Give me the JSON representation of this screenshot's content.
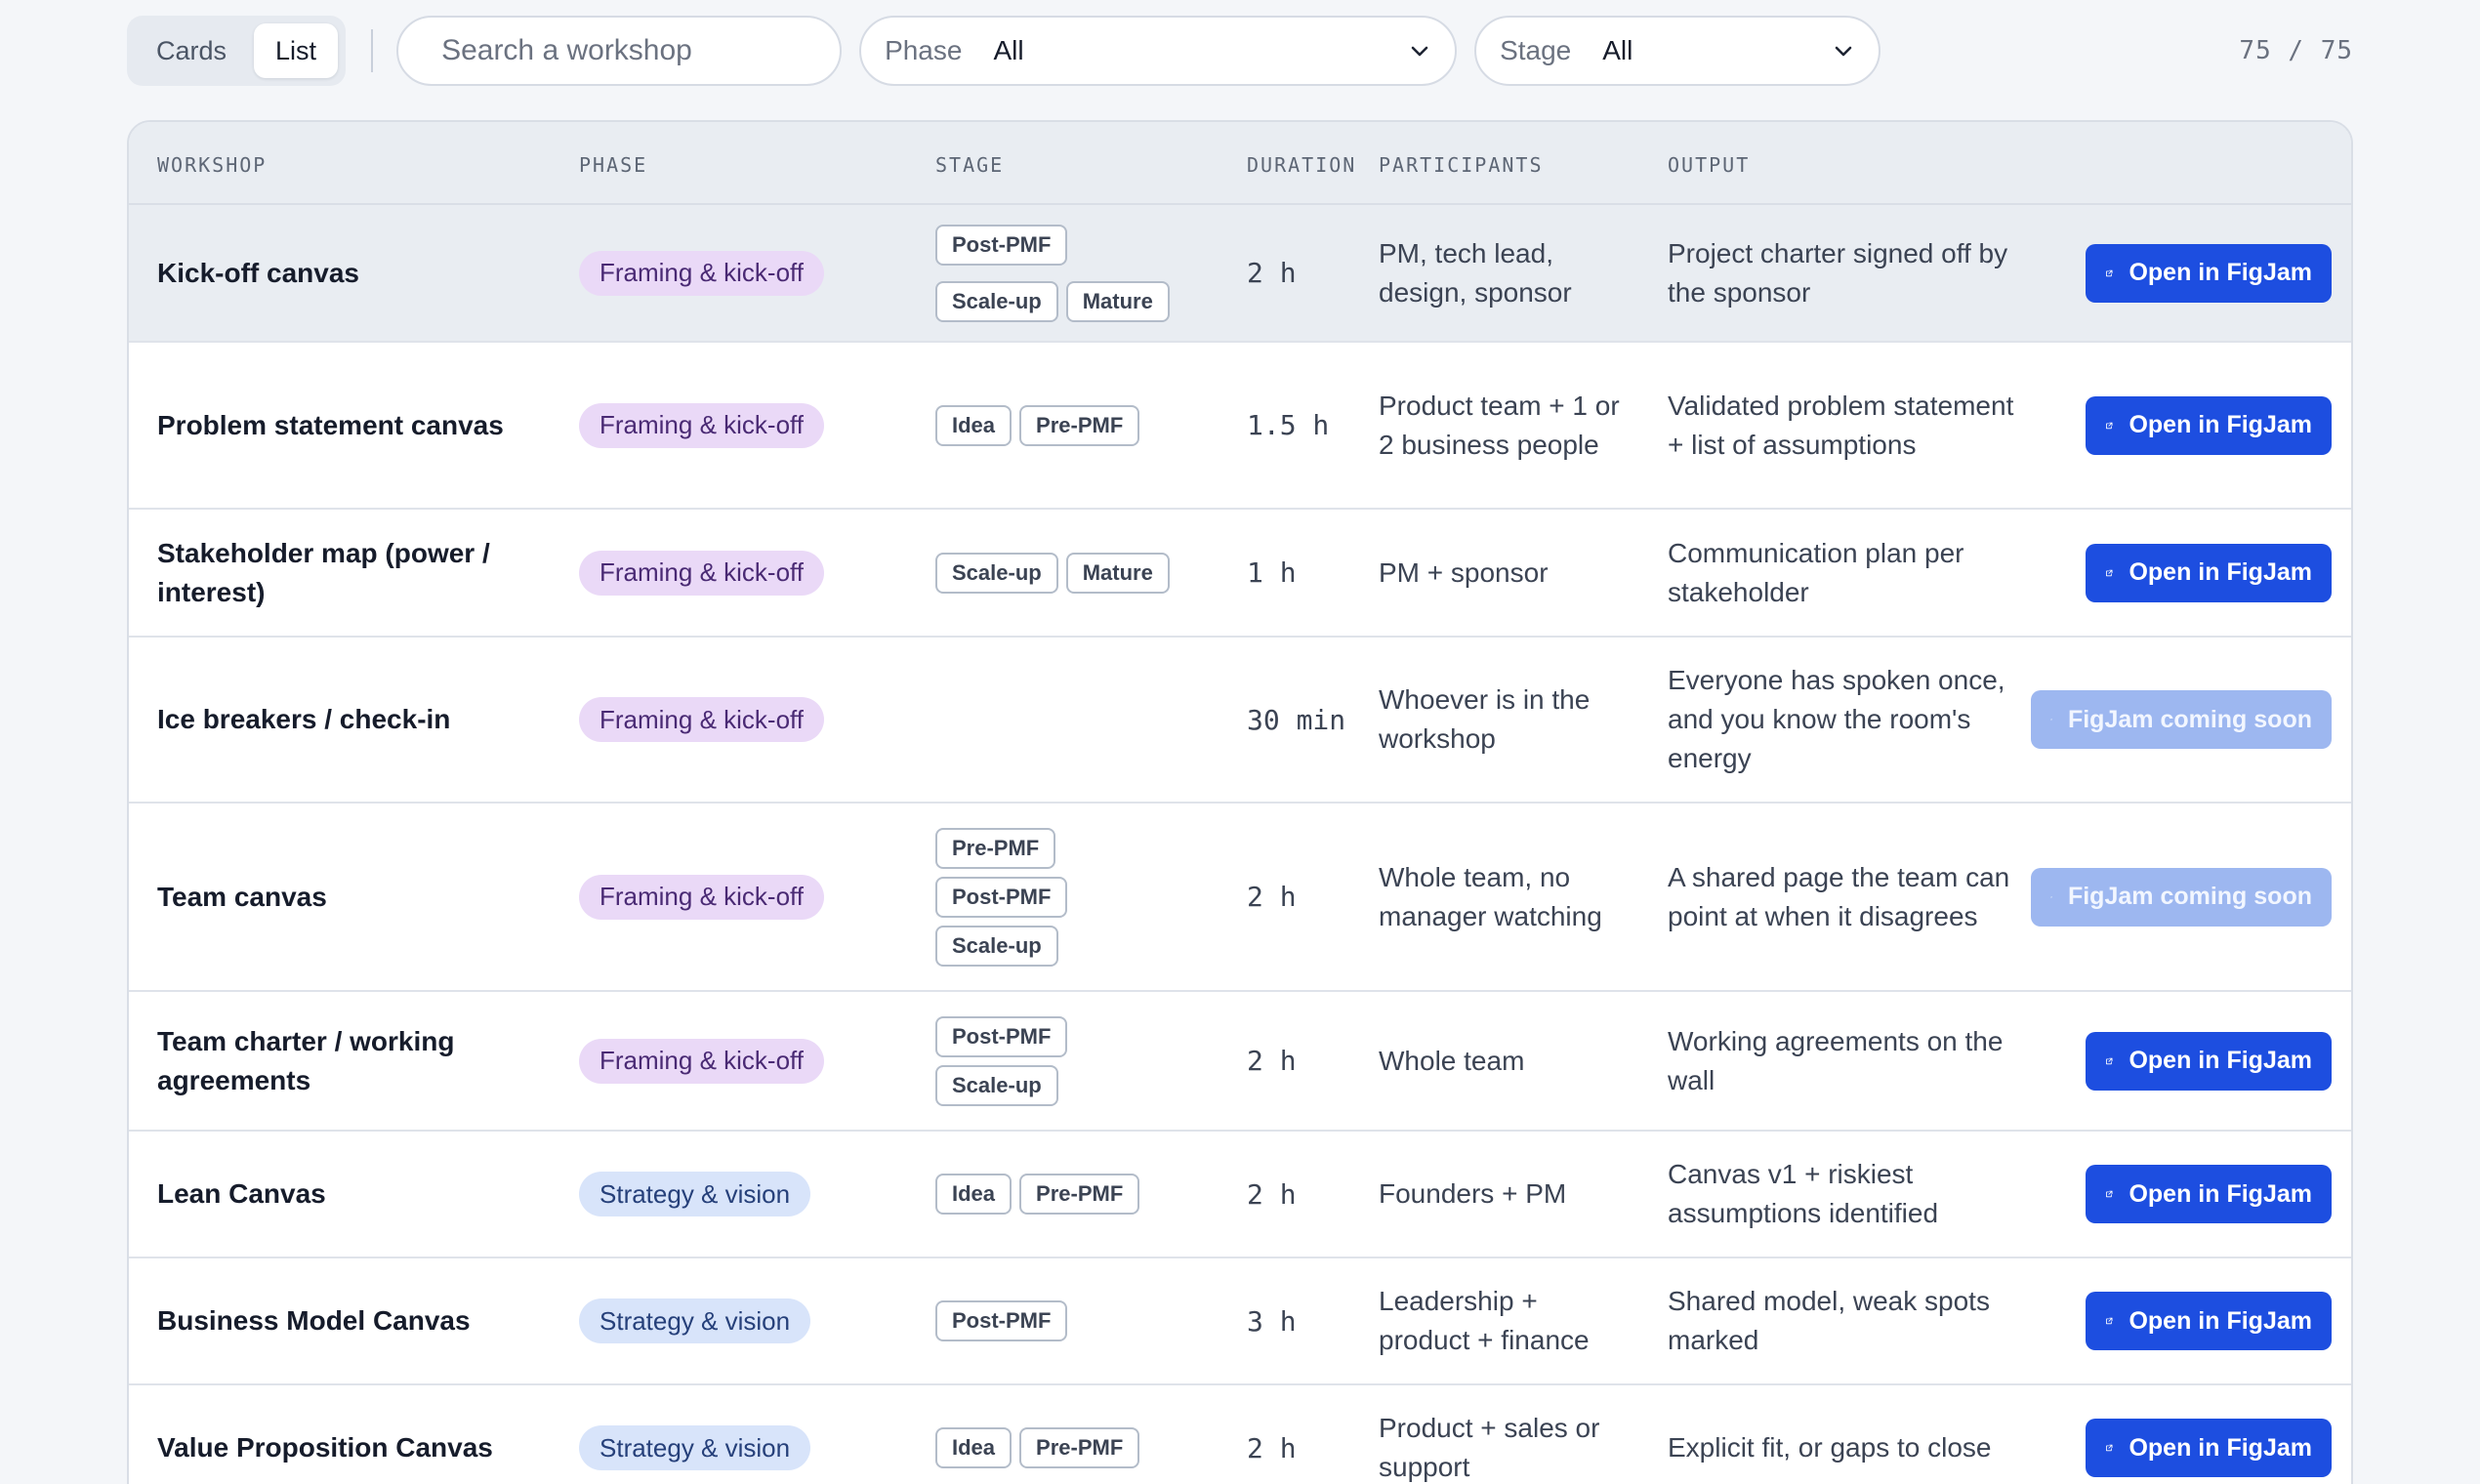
{
  "toolbar": {
    "view_cards": "Cards",
    "view_list": "List",
    "search_placeholder": "Search a workshop",
    "phase_label": "Phase",
    "phase_value": "All",
    "stage_label": "Stage",
    "stage_value": "All",
    "count": "75 / 75"
  },
  "table": {
    "headers": {
      "workshop": "WORKSHOP",
      "phase": "PHASE",
      "stage": "STAGE",
      "duration": "DURATION",
      "participants": "PARTICIPANTS",
      "output": "OUTPUT"
    },
    "rows": [
      {
        "name": "Kick-off canvas",
        "phase": "Framing & kick-off",
        "phase_kind": "framing",
        "stages": [
          "Post-PMF",
          "Scale-up",
          "Mature"
        ],
        "duration": "2 h",
        "participants": "PM, tech lead, design, sponsor",
        "output": "Project charter signed off by the sponsor",
        "action": "Open in FigJam",
        "action_enabled": true
      },
      {
        "name": "Problem statement canvas",
        "phase": "Framing & kick-off",
        "phase_kind": "framing",
        "stages": [
          "Idea",
          "Pre-PMF"
        ],
        "duration": "1.5 h",
        "participants": "Product team + 1 or 2 business people",
        "output": "Validated problem statement + list of assumptions",
        "action": "Open in FigJam",
        "action_enabled": true
      },
      {
        "name": "Stakeholder map (power / interest)",
        "phase": "Framing & kick-off",
        "phase_kind": "framing",
        "stages": [
          "Scale-up",
          "Mature"
        ],
        "duration": "1 h",
        "participants": "PM + sponsor",
        "output": "Communication plan per stakeholder",
        "action": "Open in FigJam",
        "action_enabled": true
      },
      {
        "name": "Ice breakers / check-in",
        "phase": "Framing & kick-off",
        "phase_kind": "framing",
        "stages": [],
        "duration": "30 min",
        "participants": "Whoever is in the workshop",
        "output": "Everyone has spoken once, and you know the room's energy",
        "action": "FigJam coming soon",
        "action_enabled": false
      },
      {
        "name": "Team canvas",
        "phase": "Framing & kick-off",
        "phase_kind": "framing",
        "stages": [
          "Pre-PMF",
          "Post-PMF",
          "Scale-up"
        ],
        "duration": "2 h",
        "participants": "Whole team, no manager watching",
        "output": "A shared page the team can point at when it disagrees",
        "action": "FigJam coming soon",
        "action_enabled": false
      },
      {
        "name": "Team charter / working agreements",
        "phase": "Framing & kick-off",
        "phase_kind": "framing",
        "stages": [
          "Post-PMF",
          "Scale-up"
        ],
        "duration": "2 h",
        "participants": "Whole team",
        "output": "Working agreements on the wall",
        "action": "Open in FigJam",
        "action_enabled": true
      },
      {
        "name": "Lean Canvas",
        "phase": "Strategy & vision",
        "phase_kind": "strategy",
        "stages": [
          "Idea",
          "Pre-PMF"
        ],
        "duration": "2 h",
        "participants": "Founders + PM",
        "output": "Canvas v1 + riskiest assumptions identified",
        "action": "Open in FigJam",
        "action_enabled": true
      },
      {
        "name": "Business Model Canvas",
        "phase": "Strategy & vision",
        "phase_kind": "strategy",
        "stages": [
          "Post-PMF"
        ],
        "duration": "3 h",
        "participants": "Leadership + product + finance",
        "output": "Shared model, weak spots marked",
        "action": "Open in FigJam",
        "action_enabled": true
      },
      {
        "name": "Value Proposition Canvas",
        "phase": "Strategy & vision",
        "phase_kind": "strategy",
        "stages": [
          "Idea",
          "Pre-PMF"
        ],
        "duration": "2 h",
        "participants": "Product + sales or support",
        "output": "Explicit fit, or gaps to close",
        "action": "Open in FigJam",
        "action_enabled": true
      }
    ]
  },
  "colors": {
    "accent": "#1d4ee0",
    "accent_disabled": "#9db7f0",
    "phase_framing_bg": "#ead9f7",
    "phase_strategy_bg": "#d8e4fa"
  },
  "icons": {
    "search": "search-icon",
    "chevron": "chevron-down-icon",
    "external": "external-link-icon"
  }
}
